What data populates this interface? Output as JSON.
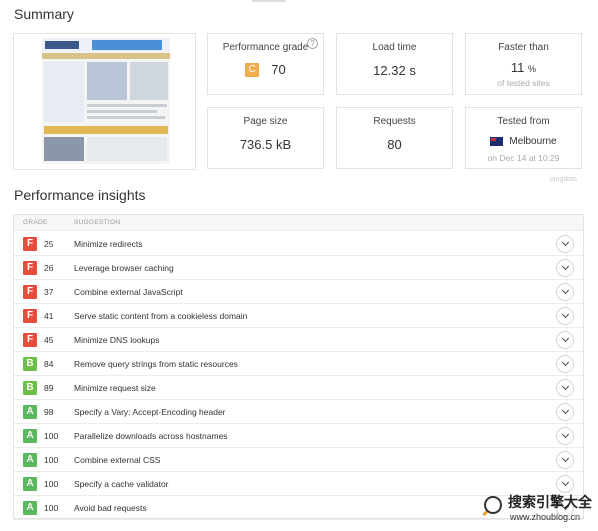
{
  "summary": {
    "title": "Summary",
    "performance_grade": {
      "label": "Performance grade",
      "letter": "C",
      "score": "70",
      "help": "?"
    },
    "load_time": {
      "label": "Load time",
      "value": "12.32 s"
    },
    "faster_than": {
      "label": "Faster than",
      "value": "11",
      "unit": "%",
      "sub": "of tested sites"
    },
    "page_size": {
      "label": "Page size",
      "value": "736.5 kB"
    },
    "requests": {
      "label": "Requests",
      "value": "80"
    },
    "tested_from": {
      "label": "Tested from",
      "location": "Melbourne",
      "date": "on Dec 14 at 10:29"
    },
    "brand": "pingdom"
  },
  "insights": {
    "title": "Performance insights",
    "headers": {
      "grade": "GRADE",
      "suggestion": "SUGGESTION"
    },
    "rows": [
      {
        "grade": "F",
        "score": "25",
        "text": "Minimize redirects"
      },
      {
        "grade": "F",
        "score": "26",
        "text": "Leverage browser caching"
      },
      {
        "grade": "F",
        "score": "37",
        "text": "Combine external JavaScript"
      },
      {
        "grade": "F",
        "score": "41",
        "text": "Serve static content from a cookieless domain"
      },
      {
        "grade": "F",
        "score": "45",
        "text": "Minimize DNS lookups"
      },
      {
        "grade": "B",
        "score": "84",
        "text": "Remove query strings from static resources"
      },
      {
        "grade": "B",
        "score": "89",
        "text": "Minimize request size"
      },
      {
        "grade": "A",
        "score": "98",
        "text": "Specify a Vary: Accept-Encoding header"
      },
      {
        "grade": "A",
        "score": "100",
        "text": "Parallelize downloads across hostnames"
      },
      {
        "grade": "A",
        "score": "100",
        "text": "Combine external CSS"
      },
      {
        "grade": "A",
        "score": "100",
        "text": "Specify a cache validator"
      },
      {
        "grade": "A",
        "score": "100",
        "text": "Avoid bad requests"
      }
    ]
  },
  "watermark": {
    "title": "搜索引擎大全",
    "url": "www.zhoublog.cn"
  },
  "colors": {
    "grade_F": "#e74c3c",
    "grade_B": "#6cbf47",
    "grade_A": "#5cb85c",
    "grade_C": "#f0ad4e"
  }
}
